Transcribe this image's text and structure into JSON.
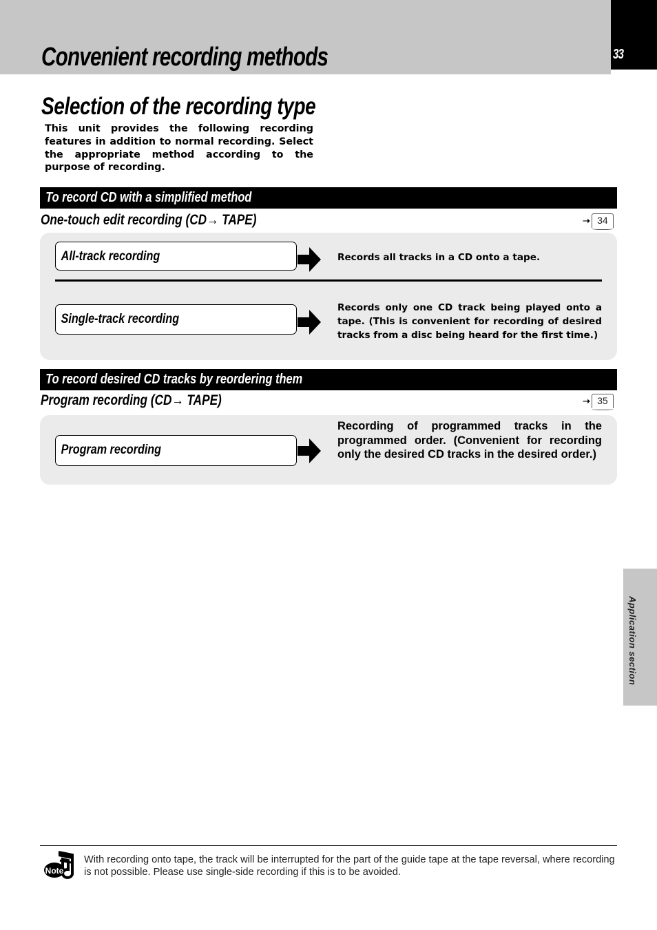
{
  "header": {
    "chapter_title": "Convenient recording methods",
    "page_number": "33"
  },
  "section": {
    "title": "Selection of the recording type",
    "intro": "This unit provides the following recording features in addition to normal recording. Select the appropriate method according to the purpose of recording."
  },
  "groups": [
    {
      "bar_label": "To record CD with a simplified method",
      "heading": "One-touch edit recording (CD→ TAPE)",
      "page_ref": "34",
      "items": [
        {
          "label": "All-track recording",
          "description": "Records all tracks in a CD onto a tape."
        },
        {
          "label": "Single-track recording",
          "description": "Records only one CD track being played onto a tape. (This is convenient for recording of desired tracks from a disc being heard for the first time.)"
        }
      ]
    },
    {
      "bar_label": "To record desired CD tracks by reordering them",
      "heading": "Program recording (CD→ TAPE)",
      "page_ref": "35",
      "items": [
        {
          "label": "Program recording",
          "description": "Recording of programmed tracks in the programmed order. (Convenient for recording only the desired CD tracks in the desired order.)"
        }
      ]
    }
  ],
  "side_tab": {
    "label": "Application section"
  },
  "note": {
    "icon_text": "Note",
    "text": "With recording onto tape, the track will be interrupted for the part of the guide tape at the tape reversal, where recording is not possible. Please use single-side recording if this is to be avoided."
  }
}
